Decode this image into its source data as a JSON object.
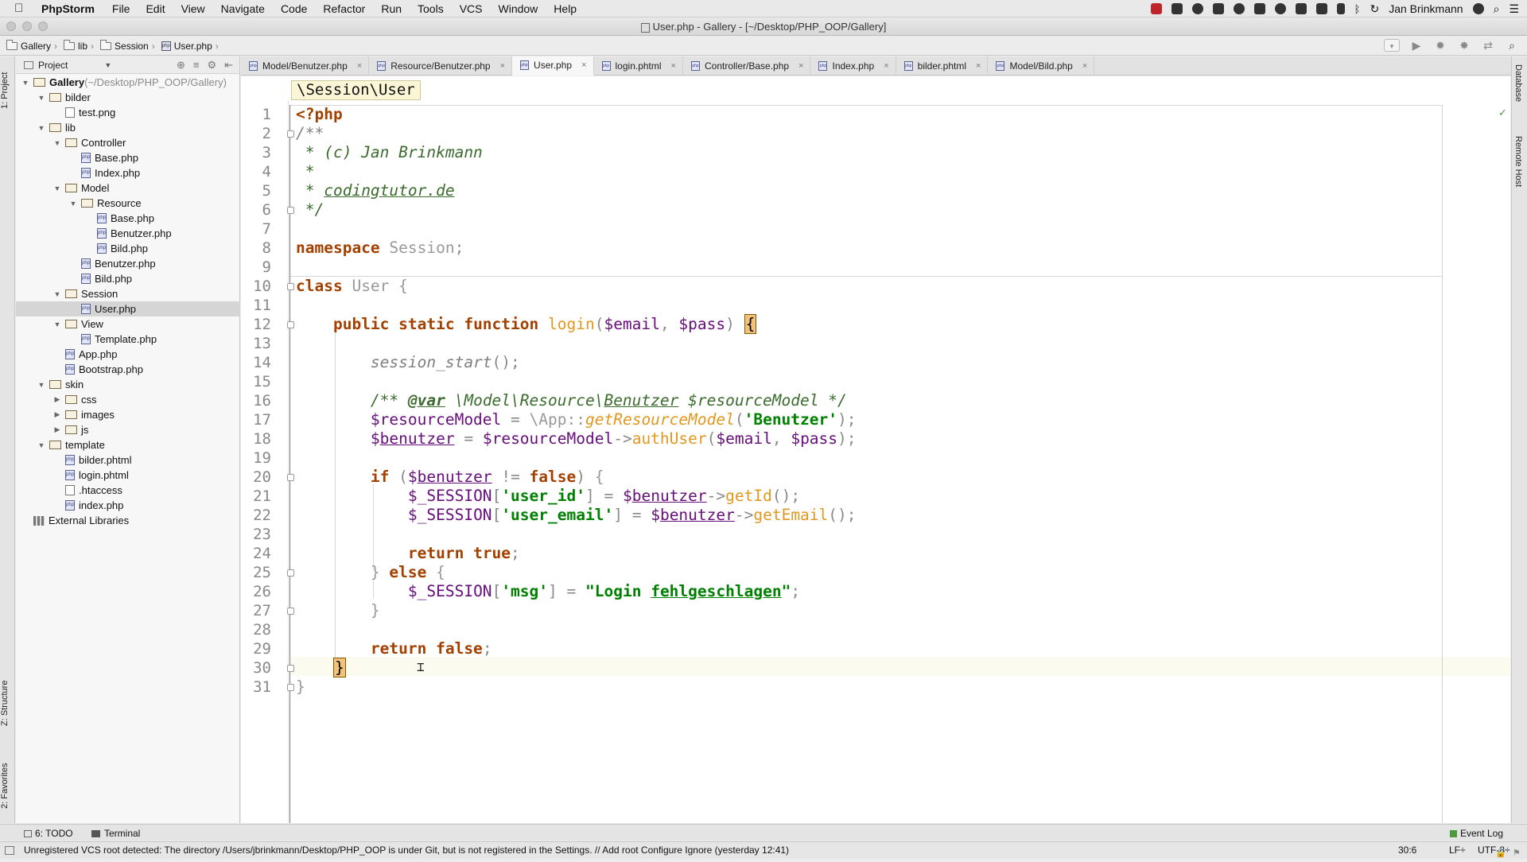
{
  "menubar": {
    "app": "PhpStorm",
    "items": [
      "File",
      "Edit",
      "View",
      "Navigate",
      "Code",
      "Refactor",
      "Run",
      "Tools",
      "VCS",
      "Window",
      "Help"
    ],
    "user": "Jan Brinkmann"
  },
  "window": {
    "title": "User.php - Gallery - [~/Desktop/PHP_OOP/Gallery]"
  },
  "navbar": {
    "crumbs": [
      "Gallery",
      "lib",
      "Session",
      "User.php"
    ]
  },
  "project": {
    "header": "Project",
    "tree": [
      {
        "label": "Gallery",
        "suffix": "(~/Desktop/PHP_OOP/Gallery)",
        "depth": 0,
        "kind": "folder",
        "open": true,
        "bold": true
      },
      {
        "label": "bilder",
        "depth": 1,
        "kind": "folder",
        "open": true
      },
      {
        "label": "test.png",
        "depth": 2,
        "kind": "image"
      },
      {
        "label": "lib",
        "depth": 1,
        "kind": "folder",
        "open": true
      },
      {
        "label": "Controller",
        "depth": 2,
        "kind": "folder",
        "open": true
      },
      {
        "label": "Base.php",
        "depth": 3,
        "kind": "php"
      },
      {
        "label": "Index.php",
        "depth": 3,
        "kind": "php"
      },
      {
        "label": "Model",
        "depth": 2,
        "kind": "folder",
        "open": true
      },
      {
        "label": "Resource",
        "depth": 3,
        "kind": "folder",
        "open": true
      },
      {
        "label": "Base.php",
        "depth": 4,
        "kind": "php"
      },
      {
        "label": "Benutzer.php",
        "depth": 4,
        "kind": "php"
      },
      {
        "label": "Bild.php",
        "depth": 4,
        "kind": "php"
      },
      {
        "label": "Benutzer.php",
        "depth": 3,
        "kind": "php"
      },
      {
        "label": "Bild.php",
        "depth": 3,
        "kind": "php"
      },
      {
        "label": "Session",
        "depth": 2,
        "kind": "folder",
        "open": true
      },
      {
        "label": "User.php",
        "depth": 3,
        "kind": "php",
        "selected": true
      },
      {
        "label": "View",
        "depth": 2,
        "kind": "folder",
        "open": true
      },
      {
        "label": "Template.php",
        "depth": 3,
        "kind": "php"
      },
      {
        "label": "App.php",
        "depth": 2,
        "kind": "php"
      },
      {
        "label": "Bootstrap.php",
        "depth": 2,
        "kind": "php"
      },
      {
        "label": "skin",
        "depth": 1,
        "kind": "folder",
        "open": true
      },
      {
        "label": "css",
        "depth": 2,
        "kind": "folder",
        "open": false
      },
      {
        "label": "images",
        "depth": 2,
        "kind": "folder",
        "open": false
      },
      {
        "label": "js",
        "depth": 2,
        "kind": "folder",
        "open": false
      },
      {
        "label": "template",
        "depth": 1,
        "kind": "folder",
        "open": true
      },
      {
        "label": "bilder.phtml",
        "depth": 2,
        "kind": "php"
      },
      {
        "label": "login.phtml",
        "depth": 2,
        "kind": "php"
      },
      {
        "label": ".htaccess",
        "depth": 2,
        "kind": "file"
      },
      {
        "label": "index.php",
        "depth": 2,
        "kind": "php"
      },
      {
        "label": "External Libraries",
        "depth": 0,
        "kind": "lib"
      }
    ]
  },
  "tabs": [
    {
      "label": "Model/Benutzer.php"
    },
    {
      "label": "Resource/Benutzer.php"
    },
    {
      "label": "User.php",
      "active": true
    },
    {
      "label": "login.phtml"
    },
    {
      "label": "Controller/Base.php"
    },
    {
      "label": "Index.php"
    },
    {
      "label": "bilder.phtml"
    },
    {
      "label": "Model/Bild.php"
    }
  ],
  "editor": {
    "breadcrumb": "\\Session\\User",
    "line_count": 31,
    "current_line": 30
  },
  "sidebars": {
    "left": [
      "1: Project",
      "Z: Structure",
      "2: Favorites"
    ],
    "right": [
      "Database",
      "Remote Host"
    ]
  },
  "toolwindows": {
    "todo": "6: TODO",
    "terminal": "Terminal",
    "eventlog": "Event Log"
  },
  "status": {
    "message": "Unregistered VCS root detected: The directory /Users/jbrinkmann/Desktop/PHP_OOP is under Git, but is not registered in the Settings. // Add root  Configure  Ignore (yesterday 12:41)",
    "position": "30:6",
    "line_sep": "LF÷",
    "encoding": "UTF-8÷"
  }
}
